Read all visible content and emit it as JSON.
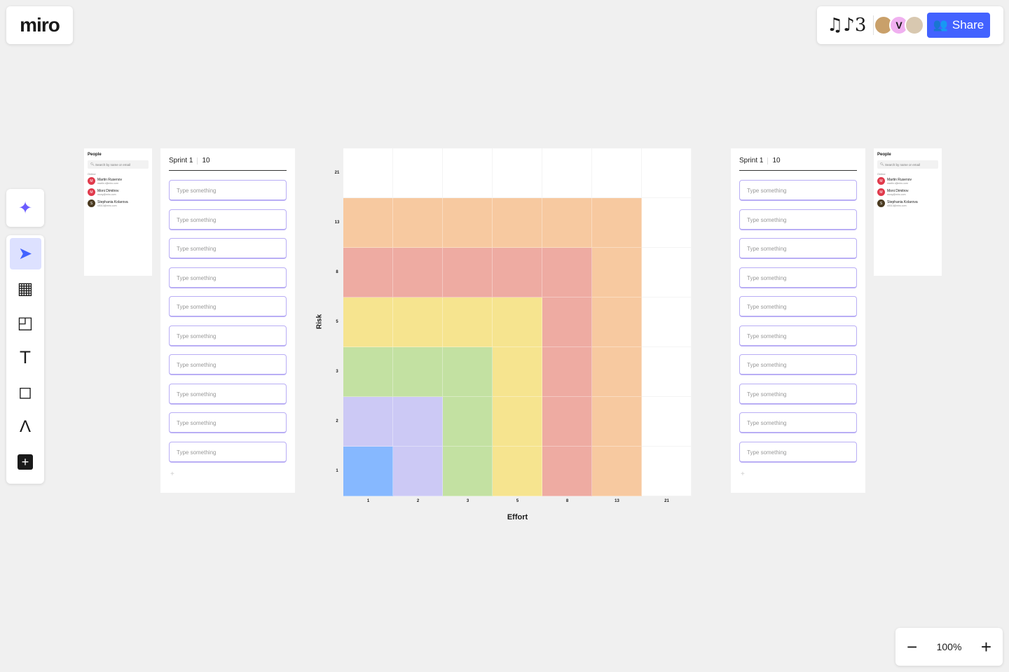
{
  "app": {
    "logo": "miro",
    "signature": "♫♪3"
  },
  "header": {
    "share_label": "Share",
    "collaborators": [
      {
        "initial": "",
        "color": "#c9a06a"
      },
      {
        "initial": "V",
        "color": "#f0b0f0"
      },
      {
        "initial": "",
        "color": "#d8c8b0"
      }
    ],
    "accent": "#4262ff"
  },
  "zoom": {
    "level": "100%",
    "minus": "−",
    "plus": "+"
  },
  "people_panel": {
    "title": "People",
    "search_placeholder": "Search by name or email",
    "section": "Online",
    "people": [
      {
        "initial": "M",
        "name": "Martin Rusenov",
        "email": "martin.r@miro.com",
        "color": "#e0394b"
      },
      {
        "initial": "M",
        "name": "Moni Dimitrov",
        "email": "mony@miro.com",
        "color": "#e0394b"
      },
      {
        "initial": "S",
        "name": "Stephania Kolarova",
        "email": "s5013@miro.com",
        "color": "#4a3a20"
      }
    ]
  },
  "sprint": {
    "title": "Sprint 1",
    "points": "10",
    "placeholder": "Type something",
    "add": "+",
    "count": 10
  },
  "chart_data": {
    "type": "heatmap",
    "xlabel": "Effort",
    "ylabel": "Risk",
    "x_ticks": [
      "1",
      "2",
      "3",
      "5",
      "8",
      "13",
      "21"
    ],
    "y_ticks": [
      "21",
      "13",
      "8",
      "5",
      "3",
      "2",
      "1"
    ],
    "colors": {
      "W": "#ffffff",
      "O": "#f7c9a0",
      "R": "#eeaba2",
      "Y": "#f6e48f",
      "G": "#c3e1a2",
      "P": "#ccc9f5",
      "B": "#86b8ff"
    },
    "cells": [
      [
        "W",
        "W",
        "W",
        "W",
        "W",
        "W",
        "W"
      ],
      [
        "O",
        "O",
        "O",
        "O",
        "O",
        "O",
        "W"
      ],
      [
        "R",
        "R",
        "R",
        "R",
        "R",
        "O",
        "W"
      ],
      [
        "Y",
        "Y",
        "Y",
        "Y",
        "R",
        "O",
        "W"
      ],
      [
        "G",
        "G",
        "G",
        "Y",
        "R",
        "O",
        "W"
      ],
      [
        "P",
        "P",
        "G",
        "Y",
        "R",
        "O",
        "W"
      ],
      [
        "B",
        "P",
        "G",
        "Y",
        "R",
        "O",
        "W"
      ]
    ]
  }
}
